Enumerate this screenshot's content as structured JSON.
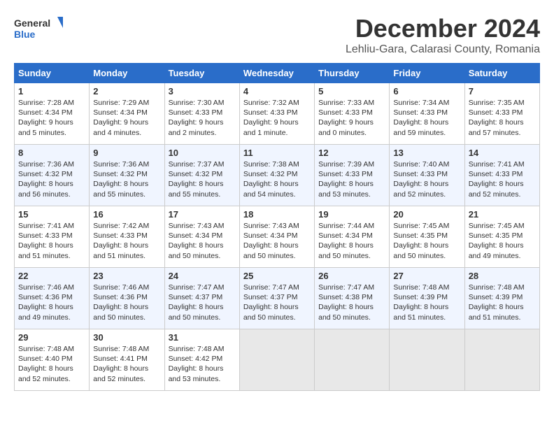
{
  "header": {
    "logo_line1": "General",
    "logo_line2": "Blue",
    "month": "December 2024",
    "location": "Lehliu-Gara, Calarasi County, Romania"
  },
  "weekdays": [
    "Sunday",
    "Monday",
    "Tuesday",
    "Wednesday",
    "Thursday",
    "Friday",
    "Saturday"
  ],
  "weeks": [
    [
      {
        "day": "1",
        "info": "Sunrise: 7:28 AM\nSunset: 4:34 PM\nDaylight: 9 hours and 5 minutes."
      },
      {
        "day": "2",
        "info": "Sunrise: 7:29 AM\nSunset: 4:34 PM\nDaylight: 9 hours and 4 minutes."
      },
      {
        "day": "3",
        "info": "Sunrise: 7:30 AM\nSunset: 4:33 PM\nDaylight: 9 hours and 2 minutes."
      },
      {
        "day": "4",
        "info": "Sunrise: 7:32 AM\nSunset: 4:33 PM\nDaylight: 9 hours and 1 minute."
      },
      {
        "day": "5",
        "info": "Sunrise: 7:33 AM\nSunset: 4:33 PM\nDaylight: 9 hours and 0 minutes."
      },
      {
        "day": "6",
        "info": "Sunrise: 7:34 AM\nSunset: 4:33 PM\nDaylight: 8 hours and 59 minutes."
      },
      {
        "day": "7",
        "info": "Sunrise: 7:35 AM\nSunset: 4:33 PM\nDaylight: 8 hours and 57 minutes."
      }
    ],
    [
      {
        "day": "8",
        "info": "Sunrise: 7:36 AM\nSunset: 4:32 PM\nDaylight: 8 hours and 56 minutes."
      },
      {
        "day": "9",
        "info": "Sunrise: 7:36 AM\nSunset: 4:32 PM\nDaylight: 8 hours and 55 minutes."
      },
      {
        "day": "10",
        "info": "Sunrise: 7:37 AM\nSunset: 4:32 PM\nDaylight: 8 hours and 55 minutes."
      },
      {
        "day": "11",
        "info": "Sunrise: 7:38 AM\nSunset: 4:32 PM\nDaylight: 8 hours and 54 minutes."
      },
      {
        "day": "12",
        "info": "Sunrise: 7:39 AM\nSunset: 4:33 PM\nDaylight: 8 hours and 53 minutes."
      },
      {
        "day": "13",
        "info": "Sunrise: 7:40 AM\nSunset: 4:33 PM\nDaylight: 8 hours and 52 minutes."
      },
      {
        "day": "14",
        "info": "Sunrise: 7:41 AM\nSunset: 4:33 PM\nDaylight: 8 hours and 52 minutes."
      }
    ],
    [
      {
        "day": "15",
        "info": "Sunrise: 7:41 AM\nSunset: 4:33 PM\nDaylight: 8 hours and 51 minutes."
      },
      {
        "day": "16",
        "info": "Sunrise: 7:42 AM\nSunset: 4:33 PM\nDaylight: 8 hours and 51 minutes."
      },
      {
        "day": "17",
        "info": "Sunrise: 7:43 AM\nSunset: 4:34 PM\nDaylight: 8 hours and 50 minutes."
      },
      {
        "day": "18",
        "info": "Sunrise: 7:43 AM\nSunset: 4:34 PM\nDaylight: 8 hours and 50 minutes."
      },
      {
        "day": "19",
        "info": "Sunrise: 7:44 AM\nSunset: 4:34 PM\nDaylight: 8 hours and 50 minutes."
      },
      {
        "day": "20",
        "info": "Sunrise: 7:45 AM\nSunset: 4:35 PM\nDaylight: 8 hours and 50 minutes."
      },
      {
        "day": "21",
        "info": "Sunrise: 7:45 AM\nSunset: 4:35 PM\nDaylight: 8 hours and 49 minutes."
      }
    ],
    [
      {
        "day": "22",
        "info": "Sunrise: 7:46 AM\nSunset: 4:36 PM\nDaylight: 8 hours and 49 minutes."
      },
      {
        "day": "23",
        "info": "Sunrise: 7:46 AM\nSunset: 4:36 PM\nDaylight: 8 hours and 50 minutes."
      },
      {
        "day": "24",
        "info": "Sunrise: 7:47 AM\nSunset: 4:37 PM\nDaylight: 8 hours and 50 minutes."
      },
      {
        "day": "25",
        "info": "Sunrise: 7:47 AM\nSunset: 4:37 PM\nDaylight: 8 hours and 50 minutes."
      },
      {
        "day": "26",
        "info": "Sunrise: 7:47 AM\nSunset: 4:38 PM\nDaylight: 8 hours and 50 minutes."
      },
      {
        "day": "27",
        "info": "Sunrise: 7:48 AM\nSunset: 4:39 PM\nDaylight: 8 hours and 51 minutes."
      },
      {
        "day": "28",
        "info": "Sunrise: 7:48 AM\nSunset: 4:39 PM\nDaylight: 8 hours and 51 minutes."
      }
    ],
    [
      {
        "day": "29",
        "info": "Sunrise: 7:48 AM\nSunset: 4:40 PM\nDaylight: 8 hours and 52 minutes."
      },
      {
        "day": "30",
        "info": "Sunrise: 7:48 AM\nSunset: 4:41 PM\nDaylight: 8 hours and 52 minutes."
      },
      {
        "day": "31",
        "info": "Sunrise: 7:48 AM\nSunset: 4:42 PM\nDaylight: 8 hours and 53 minutes."
      },
      {
        "day": "",
        "info": ""
      },
      {
        "day": "",
        "info": ""
      },
      {
        "day": "",
        "info": ""
      },
      {
        "day": "",
        "info": ""
      }
    ]
  ]
}
